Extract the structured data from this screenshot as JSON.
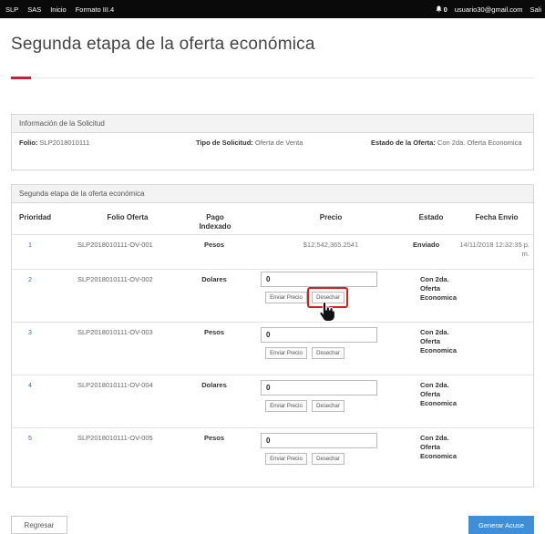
{
  "topbar": {
    "nav": [
      "SLP",
      "SAS",
      "Inicio",
      "Formato III.4"
    ],
    "notifications_count": "0",
    "user_email": "usuario30@gmail.com",
    "logout_label": "Sali"
  },
  "page": {
    "title": "Segunda etapa de la oferta económica"
  },
  "info": {
    "header": "Información de la Solicitud",
    "folio_label": "Folio:",
    "folio_value": "SLP2018010111",
    "tipo_label": "Tipo de Solicitud:",
    "tipo_value": "Oferta de Venta",
    "estado_label": "Estado de la Oferta:",
    "estado_value": "Con 2da. Oferta Economica"
  },
  "offers": {
    "header": "Segunda etapa de la oferta económica",
    "columns": {
      "prioridad": "Prioridad",
      "folio": "Folio Oferta",
      "pago": "Pago Indexado",
      "precio": "Precio",
      "estado": "Estado",
      "fecha": "Fecha Envio"
    },
    "rows": [
      {
        "prioridad": "1",
        "folio": "SLP2018010111-OV-001",
        "pago": "Pesos",
        "precio": "$12,542,365.2541",
        "estado": "Enviado",
        "fecha": "14/11/2018 12:32:35 p. m."
      },
      {
        "prioridad": "2",
        "folio": "SLP2018010111-OV-002",
        "pago": "Dolares",
        "input_value": "0",
        "send_label": "Enviar Precio",
        "reject_label": "Desechar",
        "estado": "Con 2da. Oferta Economica"
      },
      {
        "prioridad": "3",
        "folio": "SLP2018010111-OV-003",
        "pago": "Pesos",
        "input_value": "0",
        "send_label": "Enviar Precio",
        "reject_label": "Desechar",
        "estado": "Con 2da. Oferta Economica"
      },
      {
        "prioridad": "4",
        "folio": "SLP2018010111-OV-004",
        "pago": "Dolares",
        "input_value": "0",
        "send_label": "Enviar Precio",
        "reject_label": "Desechar",
        "estado": "Con 2da. Oferta Economica"
      },
      {
        "prioridad": "5",
        "folio": "SLP2018010111-OV-005",
        "pago": "Pesos",
        "input_value": "0",
        "send_label": "Enviar Precio",
        "reject_label": "Desechar",
        "estado": "Con 2da. Oferta Economica"
      }
    ]
  },
  "footer": {
    "back_label": "Regresar",
    "generate_label": "Generar Acuse"
  },
  "colors": {
    "accent": "#c0223b",
    "link": "#2a6fbf",
    "primary_button": "#3f8fd8",
    "highlight": "#d81d1d"
  },
  "icons": {
    "notifications": "bell-icon",
    "cursor": "hand-pointer-icon"
  }
}
